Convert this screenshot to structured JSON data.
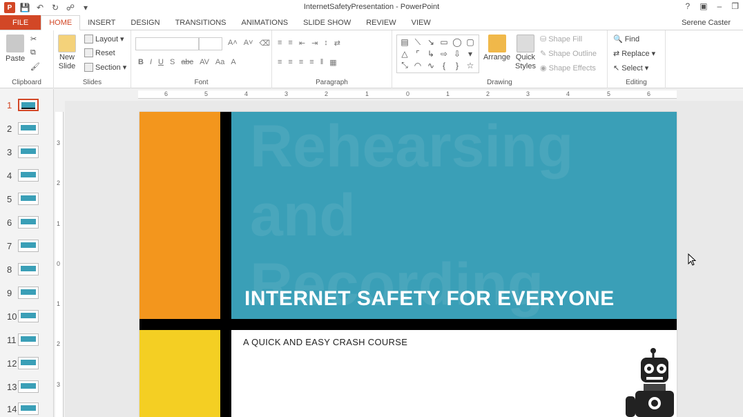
{
  "window": {
    "title": "InternetSafetyPresentation - PowerPoint",
    "user": "Serene Caster",
    "help": "?",
    "minimize": "–"
  },
  "tabs": [
    {
      "label": "FILE"
    },
    {
      "label": "HOME"
    },
    {
      "label": "INSERT"
    },
    {
      "label": "DESIGN"
    },
    {
      "label": "TRANSITIONS"
    },
    {
      "label": "ANIMATIONS"
    },
    {
      "label": "SLIDE SHOW"
    },
    {
      "label": "REVIEW"
    },
    {
      "label": "VIEW"
    }
  ],
  "ribbon": {
    "clipboard": {
      "label": "Clipboard",
      "paste": "Paste"
    },
    "slides": {
      "label": "Slides",
      "new_slide": "New",
      "new_slide2": "Slide",
      "layout": "Layout",
      "reset": "Reset",
      "section": "Section"
    },
    "font": {
      "label": "Font"
    },
    "paragraph": {
      "label": "Paragraph"
    },
    "drawing": {
      "label": "Drawing",
      "arrange": "Arrange",
      "quick": "Quick",
      "styles": "Styles",
      "shape_fill": "Shape Fill",
      "shape_outline": "Shape Outline",
      "shape_effects": "Shape Effects"
    },
    "editing": {
      "label": "Editing",
      "find": "Find",
      "replace": "Replace",
      "select": "Select"
    }
  },
  "thumbnails": [
    "1",
    "2",
    "3",
    "4",
    "5",
    "6",
    "7",
    "8",
    "9",
    "10",
    "11",
    "12",
    "13",
    "14"
  ],
  "slide": {
    "title": "INTERNET SAFETY FOR EVERYONE",
    "subtitle": "A QUICK AND EASY CRASH COURSE",
    "watermark": "Rehearsing\nand\nRecording"
  },
  "ruler": {
    "h": [
      "6",
      "5",
      "4",
      "3",
      "2",
      "1",
      "0",
      "1",
      "2",
      "3",
      "4",
      "5",
      "6"
    ],
    "v": [
      "3",
      "2",
      "1",
      "0",
      "1",
      "2",
      "3"
    ]
  },
  "colors": {
    "accent": "#d24726",
    "teal": "#3a9fb7",
    "orange": "#f3961d",
    "yellow": "#f4cf23"
  }
}
